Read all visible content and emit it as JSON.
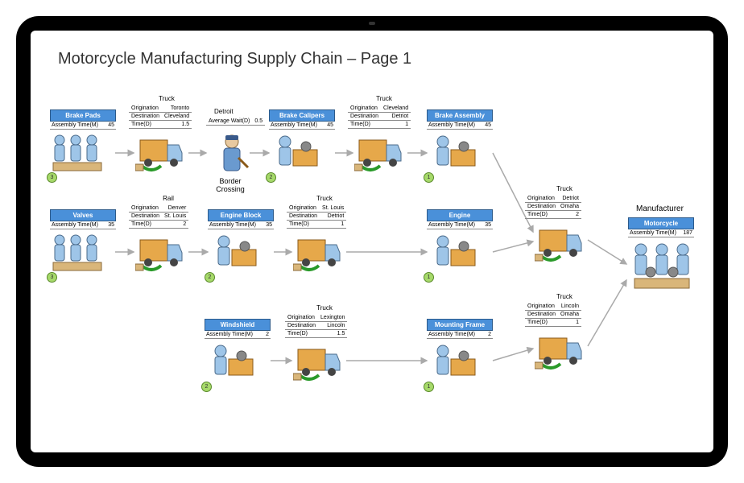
{
  "title": "Motorcycle Manufacturing Supply Chain – Page 1",
  "manufacturer_label": "Manufacturer",
  "border_crossing_label": "Border\nCrossing",
  "nodes": {
    "brake_pads": {
      "header": "Brake Pads",
      "row_label": "Assembly Time(M)",
      "row_value": "45",
      "badge": "3"
    },
    "brake_calipers": {
      "header": "Brake Calipers",
      "row_label": "Assembly Time(M)",
      "row_value": "45",
      "badge": "2"
    },
    "brake_assembly": {
      "header": "Brake Assembly",
      "row_label": "Assembly Time(M)",
      "row_value": "45",
      "badge": "1"
    },
    "valves": {
      "header": "Valves",
      "row_label": "Assembly Time(M)",
      "row_value": "35",
      "badge": "3"
    },
    "engine_block": {
      "header": "Engine Block",
      "row_label": "Assembly Time(M)",
      "row_value": "35",
      "badge": "2"
    },
    "engine": {
      "header": "Engine",
      "row_label": "Assembly Time(M)",
      "row_value": "35",
      "badge": "1"
    },
    "windshield": {
      "header": "Windshield",
      "row_label": "Assembly Time(M)",
      "row_value": "2",
      "badge": "2"
    },
    "mounting_frame": {
      "header": "Mounting Frame",
      "row_label": "Assembly Time(M)",
      "row_value": "2",
      "badge": "1"
    },
    "motorcycle": {
      "header": "Motorcycle",
      "row_label": "Assembly Time(M)",
      "row_value": "187"
    }
  },
  "trucks": {
    "t1": {
      "title": "Truck",
      "rows": [
        [
          "Origination",
          "Toronto"
        ],
        [
          "Destination",
          "Cleveland"
        ],
        [
          "Time(D)",
          "1.5"
        ]
      ]
    },
    "t2": {
      "title": "Truck",
      "rows": [
        [
          "Origination",
          "Cleveland"
        ],
        [
          "Destination",
          "Detriot"
        ],
        [
          "Time(D)",
          "1"
        ]
      ]
    },
    "t3": {
      "title": "Rail",
      "rows": [
        [
          "Origination",
          "Denver"
        ],
        [
          "Destination",
          "St. Louis"
        ],
        [
          "Time(D)",
          "2"
        ]
      ]
    },
    "t4": {
      "title": "Truck",
      "rows": [
        [
          "Origination",
          "St. Louis"
        ],
        [
          "Destination",
          "Detriot"
        ],
        [
          "Time(D)",
          "1"
        ]
      ]
    },
    "t5": {
      "title": "Truck",
      "rows": [
        [
          "Origination",
          "Lexington"
        ],
        [
          "Destination",
          "Lincoln"
        ],
        [
          "Time(D)",
          "1.5"
        ]
      ]
    },
    "t6": {
      "title": "Truck",
      "rows": [
        [
          "Origination",
          "Detriot"
        ],
        [
          "Destination",
          "Omaha"
        ],
        [
          "Time(D)",
          "2"
        ]
      ]
    },
    "t7": {
      "title": "Truck",
      "rows": [
        [
          "Origination",
          "Lincoln"
        ],
        [
          "Destination",
          "Omaha"
        ],
        [
          "Time(D)",
          "1"
        ]
      ]
    }
  },
  "border": {
    "title": "Detroit",
    "rows": [
      [
        "Average Wait(D)",
        "0.5"
      ]
    ]
  }
}
